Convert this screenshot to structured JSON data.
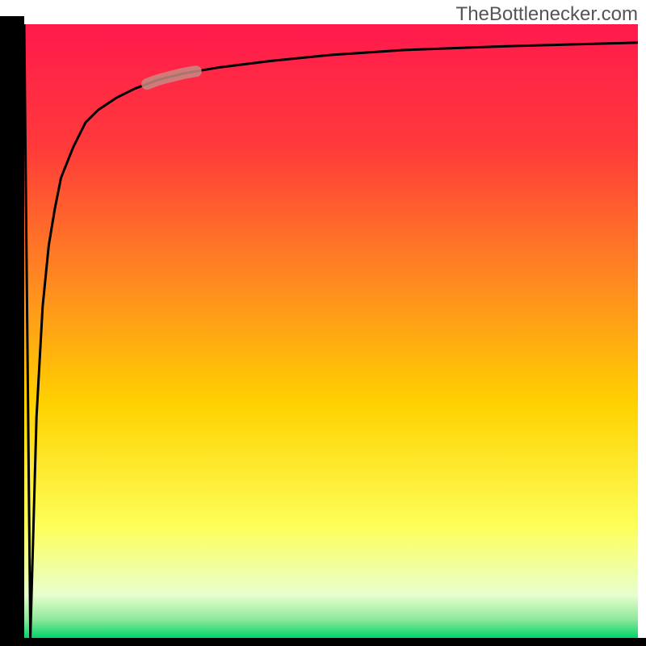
{
  "watermark": "TheBottlenecker.com",
  "chart_data": {
    "type": "line",
    "title": "",
    "xlabel": "",
    "ylabel": "",
    "x": [
      0,
      1,
      2,
      3,
      4,
      5,
      6,
      8,
      10,
      12,
      15,
      18,
      22,
      26,
      32,
      40,
      50,
      62,
      78,
      100
    ],
    "y": [
      100,
      0,
      36,
      54,
      64,
      70,
      75,
      80,
      84,
      86,
      88,
      89.5,
      91,
      92,
      93,
      94,
      95,
      95.8,
      96.4,
      97
    ],
    "y_zero_at_top": false,
    "xlim": [
      0,
      100
    ],
    "ylim": [
      0,
      100
    ],
    "highlight_segment": {
      "x_start": 20,
      "x_end": 28
    },
    "background_gradient_stops": [
      {
        "offset": 0.0,
        "color": "#ff1a4d"
      },
      {
        "offset": 0.2,
        "color": "#ff3a3a"
      },
      {
        "offset": 0.42,
        "color": "#ff8a20"
      },
      {
        "offset": 0.62,
        "color": "#ffd200"
      },
      {
        "offset": 0.82,
        "color": "#fdff5a"
      },
      {
        "offset": 0.93,
        "color": "#e8ffcf"
      },
      {
        "offset": 0.97,
        "color": "#8de89a"
      },
      {
        "offset": 1.0,
        "color": "#00d66b"
      }
    ],
    "curve_stroke": "#000000",
    "highlight_stroke": "#c88a82"
  }
}
